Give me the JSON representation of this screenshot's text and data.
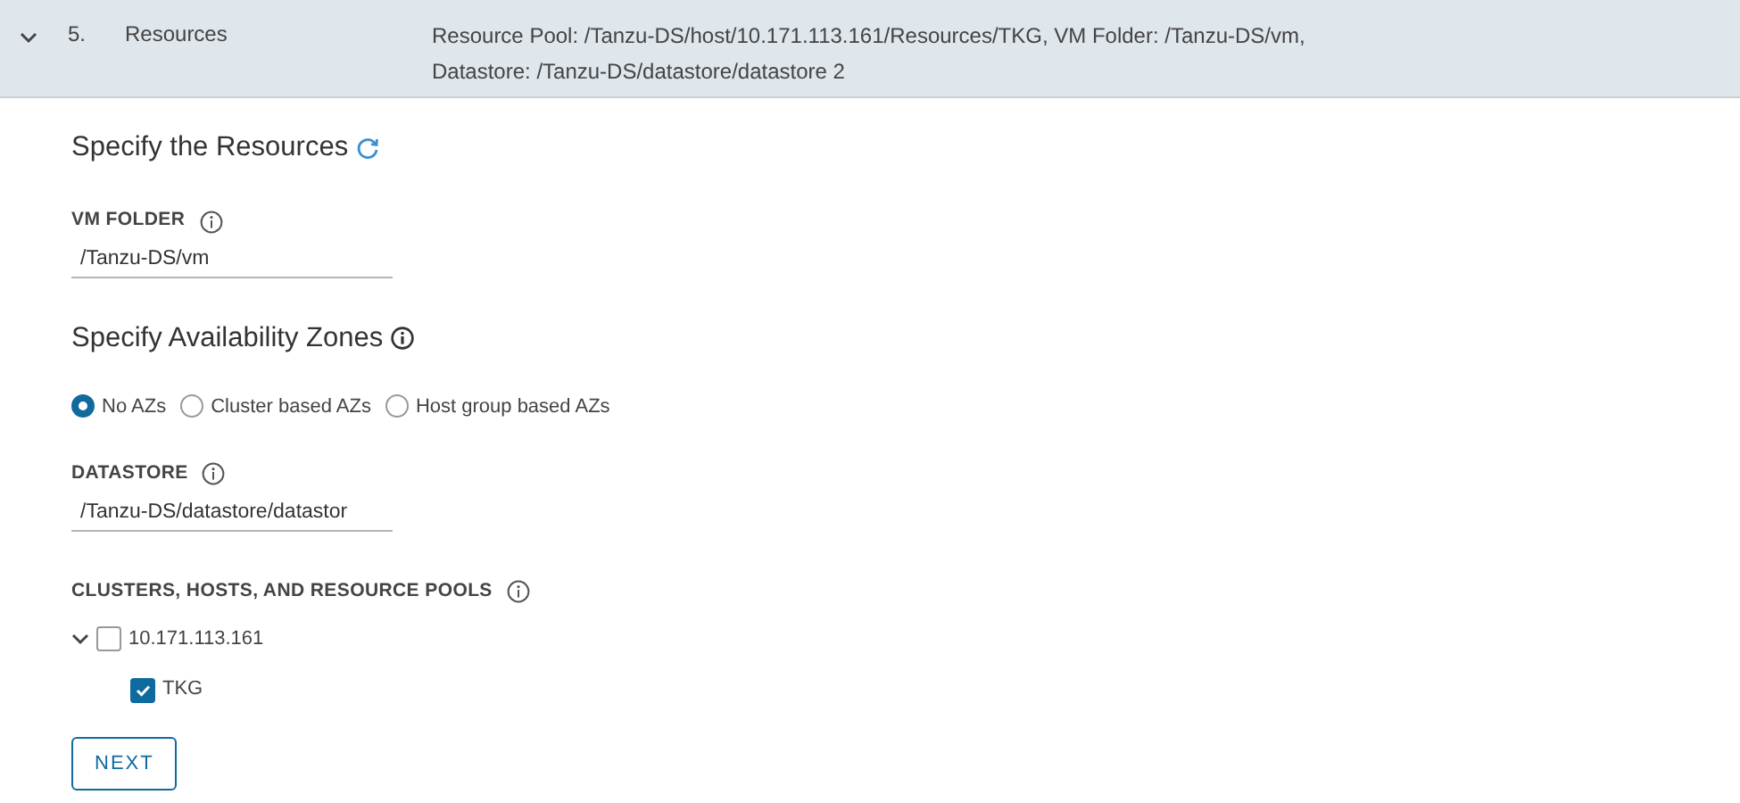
{
  "step": {
    "expanded": true,
    "number": "5.",
    "title": "Resources",
    "summary": "Resource Pool: /Tanzu-DS/host/10.171.113.161/Resources/TKG, VM Folder: /Tanzu-DS/vm, Datastore: /Tanzu-DS/datastore/datastore 2"
  },
  "resources_heading": "Specify the Resources",
  "vm_folder": {
    "label": "VM FOLDER",
    "value": "/Tanzu-DS/vm"
  },
  "az_heading": "Specify Availability Zones",
  "az_options": [
    {
      "label": "No AZs",
      "selected": true
    },
    {
      "label": "Cluster based AZs",
      "selected": false
    },
    {
      "label": "Host group based AZs",
      "selected": false
    }
  ],
  "datastore": {
    "label": "DATASTORE",
    "value": "/Tanzu-DS/datastore/datastor"
  },
  "pools_label": "CLUSTERS, HOSTS, AND RESOURCE POOLS",
  "tree": [
    {
      "label": "10.171.113.161",
      "expanded": true,
      "checked": false,
      "children": [
        {
          "label": "TKG",
          "checked": true
        }
      ]
    }
  ],
  "next_button": "NEXT"
}
